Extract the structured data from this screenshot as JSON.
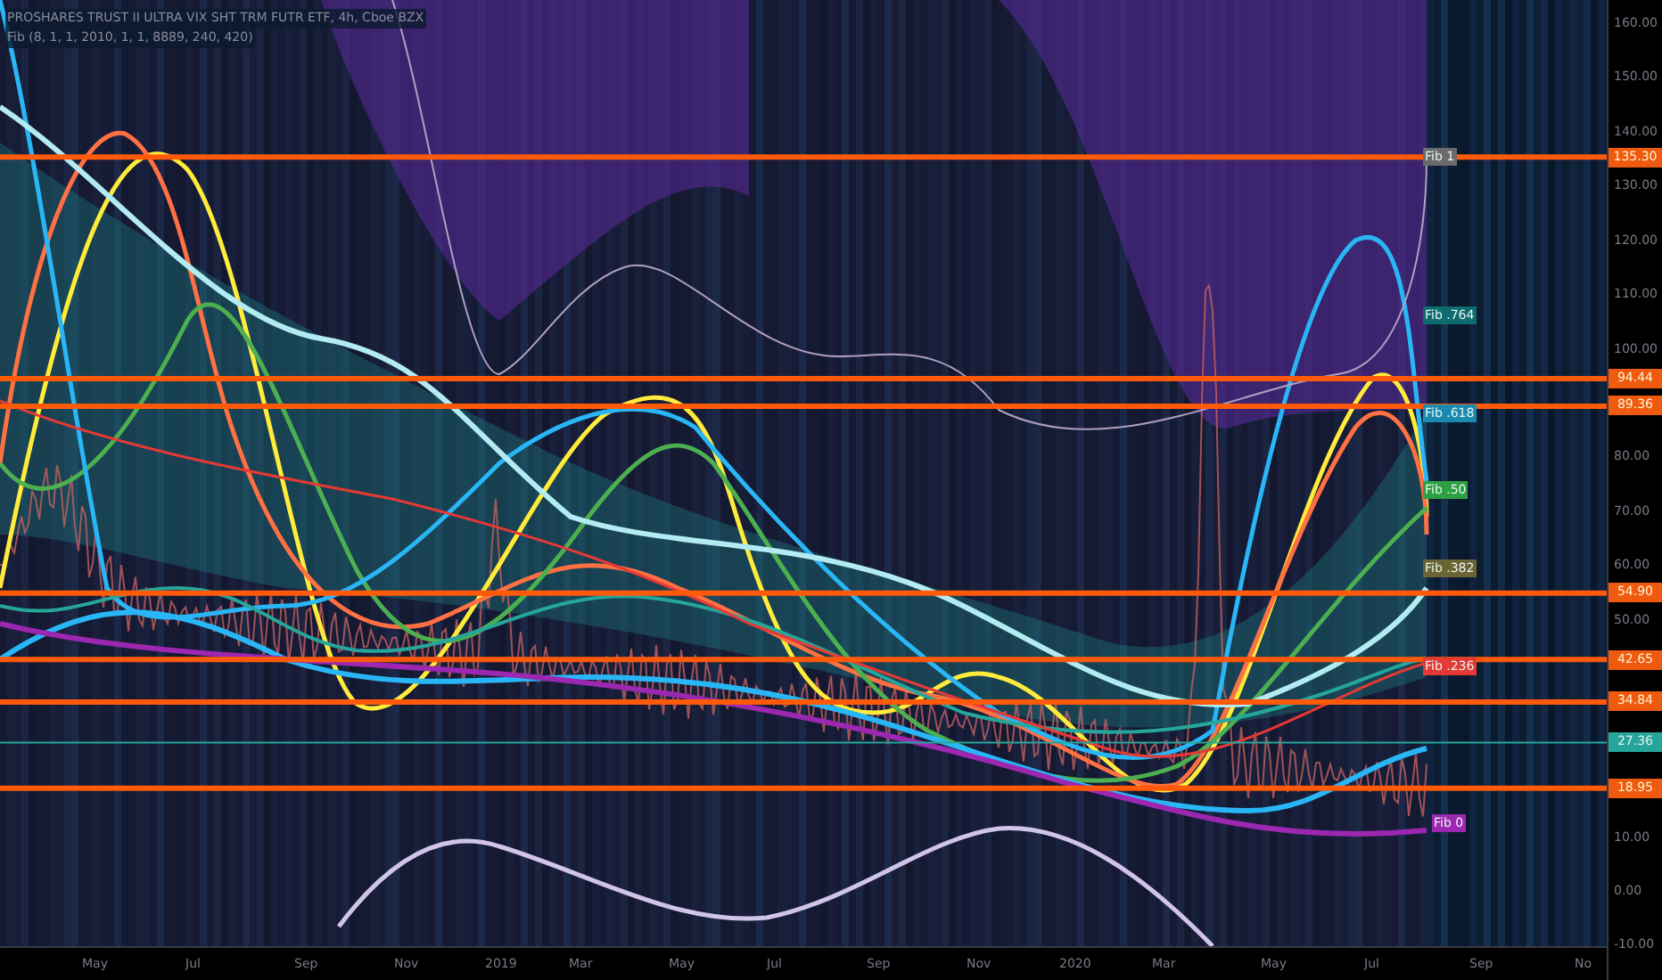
{
  "legend": {
    "symbol": "PROSHARES TRUST II ULTRA VIX SHT TRM FUTR ETF, 4h, Cboe BZX",
    "indicator": "Fib (8, 1, 1, 2010, 1, 1, 8889, 240, 420)"
  },
  "fib_labels": [
    {
      "label": "Fib 1",
      "color": "#6b6b6b"
    },
    {
      "label": "Fib .764",
      "color": "#0e6b6e"
    },
    {
      "label": "Fib .618",
      "color": "#1b8ab0"
    },
    {
      "label": "Fib .50",
      "color": "#2ea043"
    },
    {
      "label": "Fib .382",
      "color": "#6b6434"
    },
    {
      "label": "Fib .236",
      "color": "#e53935"
    },
    {
      "label": "Fib 0",
      "color": "#9c27b0"
    }
  ],
  "price_lines": [
    {
      "label": "135.30",
      "kind": "level"
    },
    {
      "label": "94.44",
      "kind": "level"
    },
    {
      "label": "89.36",
      "kind": "level"
    },
    {
      "label": "54.90",
      "kind": "level"
    },
    {
      "label": "42.65",
      "kind": "level"
    },
    {
      "label": "34.84",
      "kind": "level"
    },
    {
      "label": "27.36",
      "kind": "last"
    },
    {
      "label": "18.95",
      "kind": "level"
    }
  ],
  "price_axis": [
    "160.00",
    "150.00",
    "140.00",
    "130.00",
    "120.00",
    "110.00",
    "100.00",
    "80.00",
    "70.00",
    "60.00",
    "50.00",
    "10.00",
    "0.00",
    "-10.00"
  ],
  "time_axis": [
    "May",
    "Jul",
    "Sep",
    "Nov",
    "2019",
    "Mar",
    "May",
    "Jul",
    "Sep",
    "Nov",
    "2020",
    "Mar",
    "May",
    "Jul",
    "Sep",
    "No"
  ]
}
